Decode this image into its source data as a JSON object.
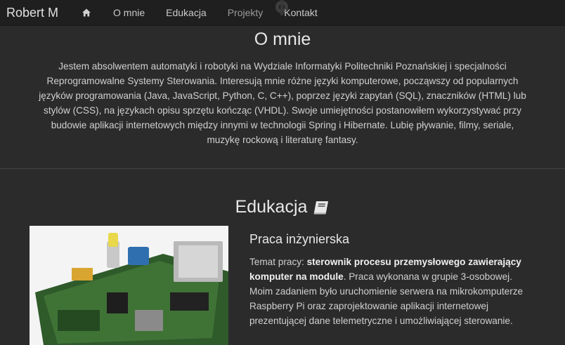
{
  "navbar": {
    "brand": "Robert M",
    "items": [
      "O mnie",
      "Edukacja",
      "Projekty",
      "Kontakt"
    ]
  },
  "about": {
    "title": "O mnie",
    "text": "Jestem absolwentem automatyki i robotyki na Wydziale Informatyki Politechniki Poznańskiej i specjalności Reprogramowalne Systemy Sterowania. Interesują mnie różne języki komputerowe, począwszy od popularnych języków programowania (Java, JavaScript, Python, C, C++), poprzez języki zapytań (SQL), znaczników (HTML) lub stylów (CSS), na językach opisu sprzętu kończąc (VHDL). Swoje umiejętności postanowiłem wykorzystywać przy budowie aplikacji internetowych między innymi w technologii Spring i Hibernate. Lubię pływanie, filmy, seriale, muzykę rockową i literaturę fantasy."
  },
  "education": {
    "title": "Edukacja",
    "thesis_heading": "Praca inżynierska",
    "topic_label": "Temat pracy:",
    "topic": "sterownik procesu przemysłowego zawierający komputer na module",
    "description": ". Praca wykonana w grupie 3-osobowej. Moim zadaniem było uruchomienie serwera na mikrokomputerze Raspberry Pi oraz zaprojektowanie aplikacji internetowej prezentującej dane telemetryczne i umożliwiającej sterowanie."
  }
}
